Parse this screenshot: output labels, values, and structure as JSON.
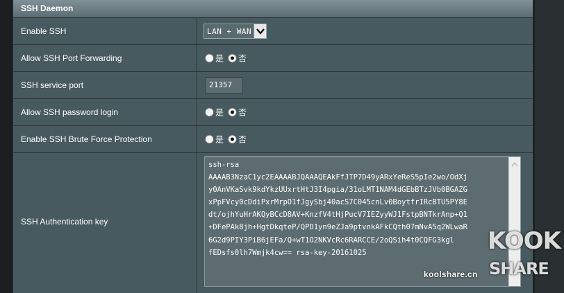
{
  "section": {
    "title": "SSH Daemon"
  },
  "rows": {
    "enable_ssh": {
      "label": "Enable SSH",
      "value": "LAN + WAN"
    },
    "port_forwarding": {
      "label": "Allow SSH Port Forwarding",
      "yes": "是",
      "no": "否",
      "selected": "no"
    },
    "service_port": {
      "label": "SSH service port",
      "value": "21357"
    },
    "password_login": {
      "label": "Allow SSH password login",
      "yes": "是",
      "no": "否",
      "selected": "no"
    },
    "brute_force": {
      "label": "Enable SSH Brute Force Protection",
      "yes": "是",
      "no": "否",
      "selected": "no"
    },
    "auth_key": {
      "label": "SSH Authentication key",
      "value": "ssh-rsa\nAAAAB3NzaC1yc2EAAAABJQAAAQEAkFfJTP7D49yARxYeReS5pIe2wo/OdXj\ny0AnVKaSvk9kdYkzUUxrtHtJ3I4pgia/31oLMT1NAM4dGEbBTzJVb0BGAZG\nxPpFVcy0cDdiPxrMrpO1fJgySbj40acS7C045cnLv0BoytfrIRcBTU5PY8E\ndt/ojhYuHrAKQyBCcD8AV+KnzfV4tHjPucV7IEZyyWJ1FstpBNTkrAnp+Q1\n+DFePAk8jh+HgtDkqteP/QPD1yn9eZJa9ptvnkAFkCQth07mNvA5q2WLwaR\n6G2d9PIY3PiB6jEFa/Q+wT1O2NKVcRc6RARCCE/2oQSih4t0CQFG3kgl\nfEDsfs0lh7Wmjk4cw== rsa-key-20161025"
    }
  },
  "watermark": {
    "site": "koolshare.cn",
    "brand_top": "KOOK",
    "brand_bottom": "SHARE"
  }
}
